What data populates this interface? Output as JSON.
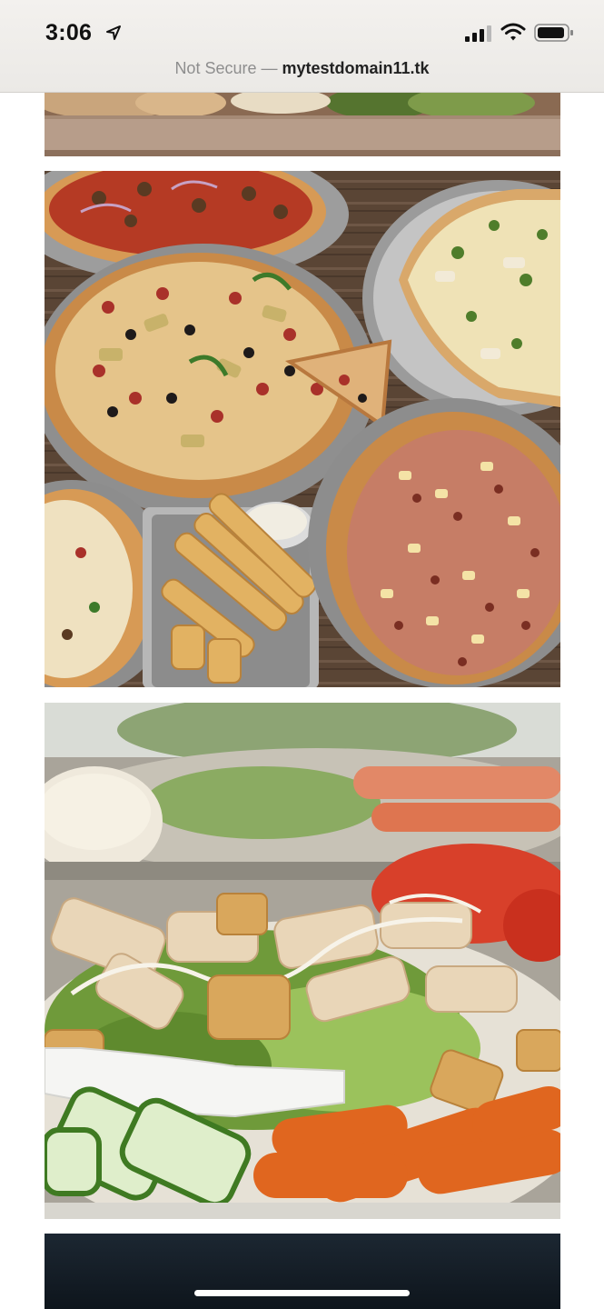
{
  "status_bar": {
    "time": "3:06",
    "location_icon": "location-arrow-icon",
    "signal_icon": "cellular-signal-icon",
    "wifi_icon": "wifi-icon",
    "battery_icon": "battery-icon"
  },
  "address_bar": {
    "security_label": "Not Secure —",
    "domain": "mytestdomain11.tk"
  },
  "gallery": {
    "images": [
      {
        "name": "pizza-tray-partial"
      },
      {
        "name": "pizzas-and-breadsticks"
      },
      {
        "name": "chicken-caesar-salad"
      },
      {
        "name": "dark-image-partial"
      }
    ]
  },
  "colors": {
    "wood": "#5b4636",
    "crust": "#d79a55",
    "sauce": "#b53a24",
    "lettuce": "#6f9a3a",
    "carrot": "#e0661f"
  }
}
